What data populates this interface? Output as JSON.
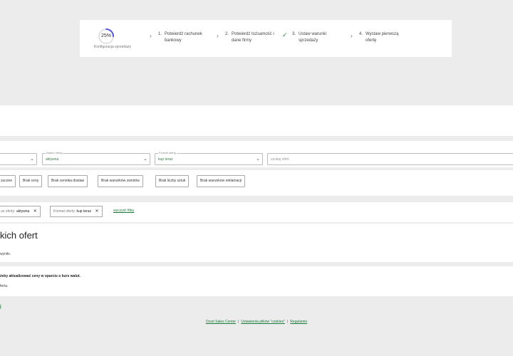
{
  "progress": {
    "percent_label": "25%",
    "percent_value": 25,
    "config_label": "Konfiguracja sprzedaży",
    "steps": [
      {
        "num": "1.",
        "label_line1": "Potwierdź rachunek",
        "label_line2": "bankowy"
      },
      {
        "num": "2.",
        "label_line1": "Potwierdź tożsamość i",
        "label_line2": "dane firmy"
      },
      {
        "num": "3.",
        "label_line1": "Ustaw warunki",
        "label_line2": "sprzedaży"
      },
      {
        "num": "4.",
        "label_line1": "Wystaw pierwszą",
        "label_line2": "ofertę"
      }
    ],
    "accent_color": "#5a58d8"
  },
  "filters": {
    "status": {
      "label": "Status oferty",
      "value": "aktywna"
    },
    "format": {
      "label": "Format oferty",
      "value": "kup teraz"
    },
    "search": {
      "placeholder": "szukaj ofert"
    }
  },
  "chips": [
    "zucone",
    "Brak ceny",
    "Brak cennika dostaw",
    "Brak warunków zwrotów",
    "Brak liczby sztuk",
    "Brak warunków reklamacji"
  ],
  "active_filters": {
    "tag1": {
      "key": "us oferty:",
      "value": "aktywna"
    },
    "tag2": {
      "key": "Format oferty:",
      "value": "kup teraz"
    },
    "clear_label": "wyczyść filtry"
  },
  "main": {
    "heading": "kich ofert",
    "results_text": "wyniki.",
    "notice_bold": "żeby aktualizować ceny w oparciu o kurs walut.",
    "notice_text": "ferta.",
    "green_fragment": "j"
  },
  "footer": {
    "link1": "Ocań Sales Center",
    "sep": "|",
    "link2": "Ustawienia plików \"cookies\"",
    "link3": "Regulamin"
  }
}
